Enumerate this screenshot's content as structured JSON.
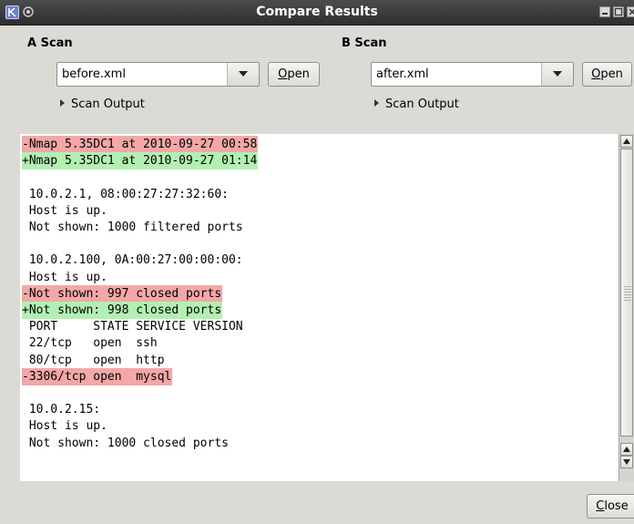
{
  "window": {
    "title": "Compare Results",
    "appIcon": "app-menu-icon",
    "pinIcon": "pin-icon",
    "controls": [
      "minimize-icon",
      "maximize-icon",
      "close-window-icon"
    ]
  },
  "a_scan": {
    "label": "A Scan",
    "file": "before.xml",
    "open_prefix": "",
    "open_mnemonic": "O",
    "open_rest": "pen",
    "expander": "Scan Output"
  },
  "b_scan": {
    "label": "B Scan",
    "file": "after.xml",
    "open_prefix": "",
    "open_mnemonic": "O",
    "open_rest": "pen",
    "expander": "Scan Output"
  },
  "diff": {
    "lines": [
      {
        "text": "-Nmap 5.35DC1 at 2010-09-27 00:58",
        "type": "del"
      },
      {
        "text": "+Nmap 5.35DC1 at 2010-09-27 01:14",
        "type": "add"
      },
      {
        "text": "",
        "type": "ctx"
      },
      {
        "text": " 10.0.2.1, 08:00:27:27:32:60:",
        "type": "ctx"
      },
      {
        "text": " Host is up.",
        "type": "ctx"
      },
      {
        "text": " Not shown: 1000 filtered ports",
        "type": "ctx"
      },
      {
        "text": "",
        "type": "ctx"
      },
      {
        "text": " 10.0.2.100, 0A:00:27:00:00:00:",
        "type": "ctx"
      },
      {
        "text": " Host is up.",
        "type": "ctx"
      },
      {
        "text": "-Not shown: 997 closed ports",
        "type": "del"
      },
      {
        "text": "+Not shown: 998 closed ports",
        "type": "add"
      },
      {
        "text": " PORT     STATE SERVICE VERSION",
        "type": "ctx"
      },
      {
        "text": " 22/tcp   open  ssh",
        "type": "ctx"
      },
      {
        "text": " 80/tcp   open  http",
        "type": "ctx"
      },
      {
        "text": "-3306/tcp open  mysql",
        "type": "del"
      },
      {
        "text": "",
        "type": "ctx"
      },
      {
        "text": " 10.0.2.15:",
        "type": "ctx"
      },
      {
        "text": " Host is up.",
        "type": "ctx"
      },
      {
        "text": " Not shown: 1000 closed ports",
        "type": "ctx"
      }
    ],
    "colors": {
      "del": "#f4a7a7",
      "add": "#b2f0b2"
    }
  },
  "footer": {
    "close_mnemonic": "C",
    "close_rest": "lose"
  }
}
